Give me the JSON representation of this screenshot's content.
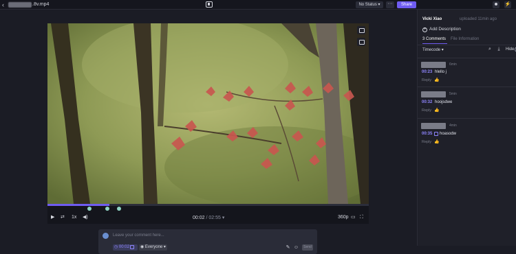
{
  "header": {
    "file_name": ".8v.mp4",
    "status_label": "No Status",
    "more_label": "···",
    "share_label": "Share"
  },
  "player": {
    "current_time": "00:02",
    "duration": "02:55",
    "speed_label": "1x",
    "quality_label": "360p",
    "progress": 0.0114
  },
  "composer": {
    "placeholder": "Leave your comment here...",
    "timecode": "00:02",
    "audience": "Everyone",
    "send_label": "Send"
  },
  "sidebar": {
    "uploader": "Vicki Xiao",
    "uploaded": "uploaded 11min ago",
    "add_description": "Add Description",
    "tabs": [
      "3 Comments",
      "File Information"
    ],
    "sort_label": "Timecode",
    "hide_label": "Hide"
  },
  "comments": [
    {
      "age": "6min",
      "time": "00:23",
      "text": "hlello j",
      "reply": "Reply"
    },
    {
      "age": "5min",
      "time": "00:32",
      "text": "hoojsdwe",
      "reply": "Reply"
    },
    {
      "age": "4min",
      "time": "00:35",
      "text": "hoasodw",
      "reply": "Reply"
    }
  ],
  "colors": {
    "accent": "#6f5cf1",
    "timecode": "#8f85ff",
    "marker": "#8fd4c4"
  }
}
